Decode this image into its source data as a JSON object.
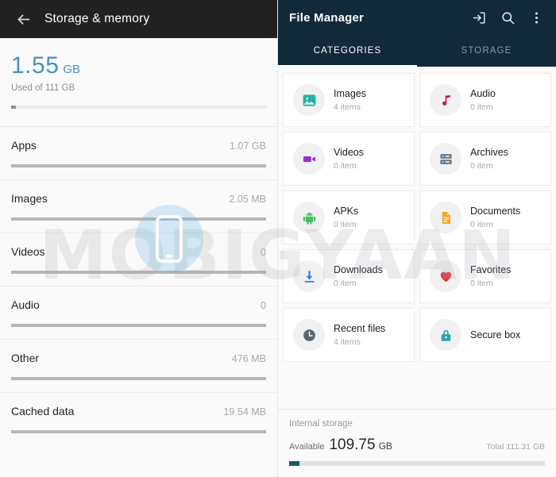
{
  "left": {
    "appbar": {
      "back_icon": "back-arrow-icon",
      "title": "Storage & memory"
    },
    "summary": {
      "used_value": "1.55",
      "used_unit": "GB",
      "subtitle": "Used of 111 GB",
      "bar_percent": 2
    },
    "rows": [
      {
        "name": "Apps",
        "value": "1.07 GB",
        "bar_percent": 100
      },
      {
        "name": "Images",
        "value": "2.05 MB",
        "bar_percent": 100
      },
      {
        "name": "Videos",
        "value": "0",
        "bar_percent": 100
      },
      {
        "name": "Audio",
        "value": "0",
        "bar_percent": 100
      },
      {
        "name": "Other",
        "value": "476 MB",
        "bar_percent": 100
      },
      {
        "name": "Cached data",
        "value": "19.54 MB",
        "bar_percent": 100
      }
    ]
  },
  "right": {
    "appbar": {
      "title": "File Manager",
      "actions": [
        {
          "icon": "transfer-to-device-icon"
        },
        {
          "icon": "search-icon"
        },
        {
          "icon": "overflow-menu-icon"
        }
      ]
    },
    "tabs": [
      {
        "label": "CATEGORIES",
        "active": true
      },
      {
        "label": "STORAGE",
        "active": false
      }
    ],
    "categories": [
      {
        "title": "Images",
        "sub": "4 items",
        "icon": "image-icon",
        "color": "#26b3a6"
      },
      {
        "title": "Audio",
        "sub": "0 item",
        "icon": "music-note-icon",
        "color": "#c2185b"
      },
      {
        "title": "Videos",
        "sub": "0 item",
        "icon": "video-camera-icon",
        "color": "#8e34d6"
      },
      {
        "title": "Archives",
        "sub": "0 item",
        "icon": "archive-icon",
        "color": "#62798a"
      },
      {
        "title": "APKs",
        "sub": "0 item",
        "icon": "android-icon",
        "color": "#3ec15a"
      },
      {
        "title": "Documents",
        "sub": "0 item",
        "icon": "document-icon",
        "color": "#f0a92a"
      },
      {
        "title": "Downloads",
        "sub": "0 item",
        "icon": "download-icon",
        "color": "#2a7fe0"
      },
      {
        "title": "Favorites",
        "sub": "0 item",
        "icon": "heart-icon",
        "color": "#e03b3b"
      },
      {
        "title": "Recent files",
        "sub": "4 items",
        "icon": "clock-icon",
        "color": "#5d6670"
      },
      {
        "title": "Secure box",
        "sub": "",
        "icon": "lock-icon",
        "color": "#2aa5b5"
      }
    ],
    "storage_footer": {
      "label": "Internal storage",
      "available_key": "Available",
      "available_value": "109.75",
      "available_unit": "GB",
      "total": "Total 111.31 GB",
      "used_percent": 4
    }
  },
  "watermark": {
    "text": "MOBIGYAAN"
  }
}
